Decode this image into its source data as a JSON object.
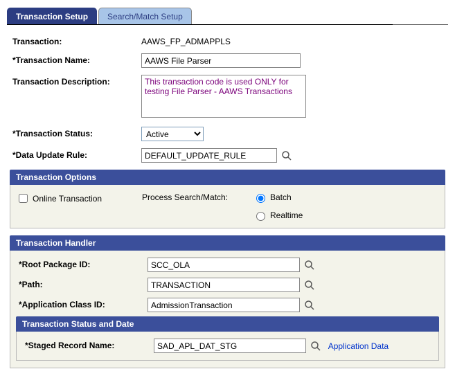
{
  "tabs": {
    "active": "Transaction Setup",
    "inactive": "Search/Match Setup"
  },
  "transaction": {
    "label": "Transaction:",
    "value": "AAWS_FP_ADMAPPLS"
  },
  "transaction_name": {
    "label": "*Transaction Name:",
    "value": "AAWS File Parser"
  },
  "transaction_description": {
    "label": "Transaction Description:",
    "value": "This transaction code is used ONLY for testing File Parser - AAWS Transactions"
  },
  "transaction_status": {
    "label": "*Transaction Status:",
    "value": "Active",
    "options": [
      "Active"
    ]
  },
  "data_update_rule": {
    "label": "*Data Update Rule:",
    "value": "DEFAULT_UPDATE_RULE"
  },
  "transaction_options": {
    "header": "Transaction Options",
    "online_transaction": {
      "label": "Online Transaction",
      "checked": false
    },
    "process_search_match": {
      "label": "Process Search/Match:",
      "batch": {
        "label": "Batch",
        "selected": true
      },
      "realtime": {
        "label": "Realtime",
        "selected": false
      }
    }
  },
  "transaction_handler": {
    "header": "Transaction Handler",
    "root_package_id": {
      "label": "*Root Package ID:",
      "value": "SCC_OLA"
    },
    "path": {
      "label": "*Path:",
      "value": "TRANSACTION"
    },
    "application_class_id": {
      "label": "*Application Class ID:",
      "value": "AdmissionTransaction"
    }
  },
  "transaction_status_date": {
    "header": "Transaction Status and Date",
    "staged_record_name": {
      "label": "*Staged Record Name:",
      "value": "SAD_APL_DAT_STG"
    },
    "application_data_link": "Application Data"
  }
}
